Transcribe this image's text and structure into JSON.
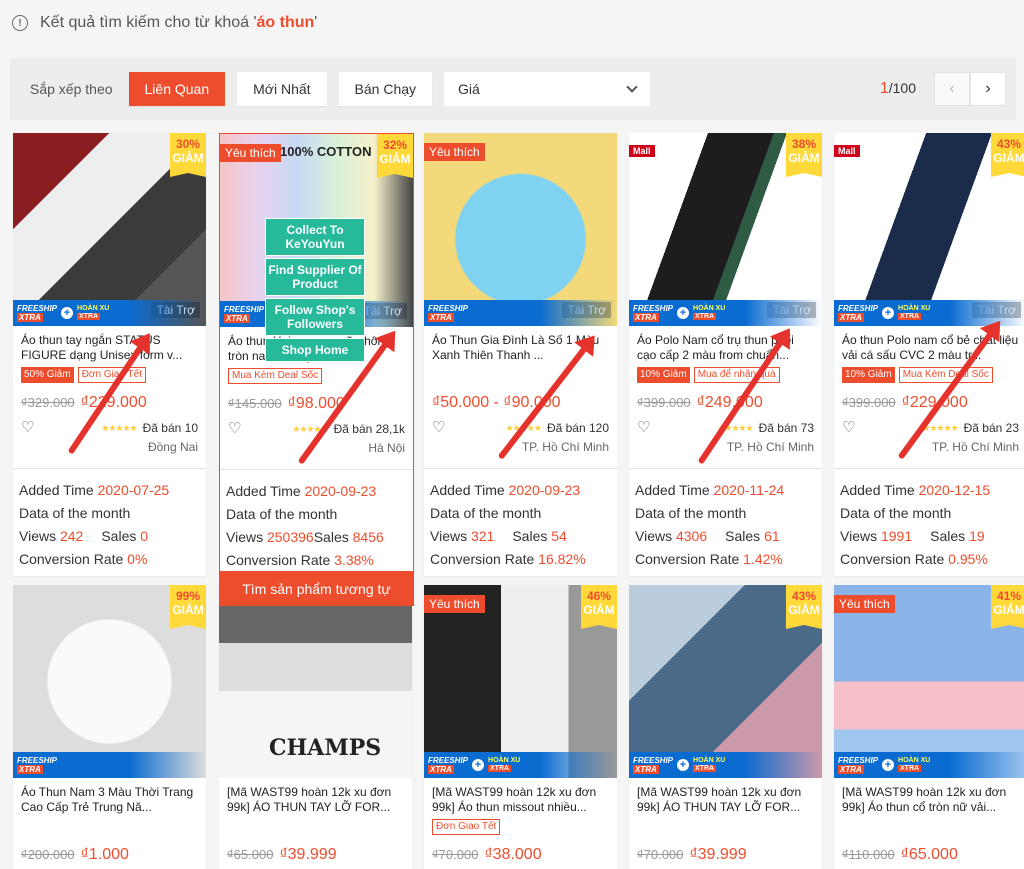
{
  "search": {
    "prefix": "Kết quả tìm kiếm cho từ khoá '",
    "keyword": "áo thun",
    "suffix": "'"
  },
  "sort": {
    "label": "Sắp xếp theo",
    "options": [
      "Liên Quan",
      "Mới Nhất",
      "Bán Chạy"
    ],
    "active": "Liên Quan",
    "price_label": "Giá"
  },
  "pager": {
    "current": "1",
    "total": "/100"
  },
  "labels": {
    "sponsored": "Tài Trợ",
    "favorite": "Yêu thích",
    "mall": "Mall",
    "discount_word": "GIẢM",
    "freeship": "FREESHIP",
    "xtra": "XTRA",
    "hoanxu": "HOÀN XU",
    "added_time": "Added Time",
    "data_month": "Data of the month",
    "views": "Views",
    "sales": "Sales",
    "conversion": "Conversion Rate",
    "similar": "Tìm sản phẩm tương tự",
    "cotton": "100% COTTON"
  },
  "hover_menu": [
    "Collect To KeYouYun",
    "Find Supplier Of Product",
    "Follow Shop's Followers",
    "Shop Home"
  ],
  "products": [
    {
      "name": "Áo thun tay ngắn STATUS FIGURE dạng Unisex form v...",
      "discount": "30%",
      "badges": [
        "50% Giảm",
        "Đơn Giao Tết"
      ],
      "old": "₫329.000",
      "price": "₫229.000",
      "sold": "Đã bán 10",
      "loc": "Đồng Nai",
      "added": "2020-07-25",
      "views": "242",
      "sales": "0",
      "conv": "0%"
    },
    {
      "name": "Áo thun Unisex nam nữ phông tròn nam nữ tay lỡ",
      "discount": "32%",
      "badges": [
        "Mua Kèm Deal Sốc"
      ],
      "old": "₫145.000",
      "price": "₫98.000",
      "sold": "Đã bán 28,1k",
      "loc": "Hà Nội",
      "added": "2020-09-23",
      "views": "250396",
      "sales": "8456",
      "conv": "3.38%"
    },
    {
      "name": "Áo Thun Gia Đình Là Số 1 Màu Xanh Thiên Thanh ...",
      "discount": "",
      "badges": [],
      "old": "",
      "price": "₫50.000 - ₫90.000",
      "sold": "Đã bán 120",
      "loc": "TP. Hồ Chí Minh",
      "added": "2020-09-23",
      "views": "321",
      "sales": "54",
      "conv": "16.82%"
    },
    {
      "name": "Áo Polo Nam cổ trụ thun phối cạo cấp 2 màu from chuẩn...",
      "discount": "38%",
      "badges": [
        "10% Giảm",
        "Mua để nhận quà"
      ],
      "old": "₫399.000",
      "price": "₫249.000",
      "sold": "Đã bán 73",
      "loc": "TP. Hồ Chí Minh",
      "added": "2020-11-24",
      "views": "4306",
      "sales": "61",
      "conv": "1.42%"
    },
    {
      "name": "Áo thun Polo nam cổ bẻ chất liệu vải cá sấu CVC 2 màu tr...",
      "discount": "43%",
      "badges": [
        "10% Giảm",
        "Mua Kèm Deal Sốc"
      ],
      "old": "₫399.000",
      "price": "₫229.000",
      "sold": "Đã bán 23",
      "loc": "TP. Hồ Chí Minh",
      "added": "2020-12-15",
      "views": "1991",
      "sales": "19",
      "conv": "0.95%"
    },
    {
      "name": "Áo Thun Nam 3 Màu Thời Trang Cao Cấp Trẻ Trung Nă...",
      "discount": "99%",
      "badges": [],
      "old": "₫200.000",
      "price": "₫1.000"
    },
    {
      "name": "[Mã WAST99 hoàn 12k xu đơn 99k] ÁO THUN TAY LỠ FOR...",
      "discount": "",
      "badges": [],
      "old": "₫65.000",
      "price": "₫39.999",
      "img_text": "CHAMPS"
    },
    {
      "name": "[Mã WAST99 hoàn 12k xu đơn 99k] Áo thun missout nhiều...",
      "discount": "46%",
      "badges": [
        "Đơn Giao Tết"
      ],
      "old": "₫70.000",
      "price": "₫38.000"
    },
    {
      "name": "[Mã WAST99 hoàn 12k xu đơn 99k] ÁO THUN TAY LỠ FOR...",
      "discount": "43%",
      "badges": [],
      "old": "₫70.000",
      "price": "₫39.999"
    },
    {
      "name": "[Mã WAST99 hoàn 12k xu đơn 99k] Áo thun cổ tròn nữ vải...",
      "discount": "41%",
      "badges": [],
      "old": "₫110.000",
      "price": "₫65.000"
    }
  ],
  "colors": {
    "accent": "#ee4d2d",
    "teal": "#26b99a",
    "freeship_blue": "#0a6bd1",
    "discount_yellow": "#ffd839"
  }
}
